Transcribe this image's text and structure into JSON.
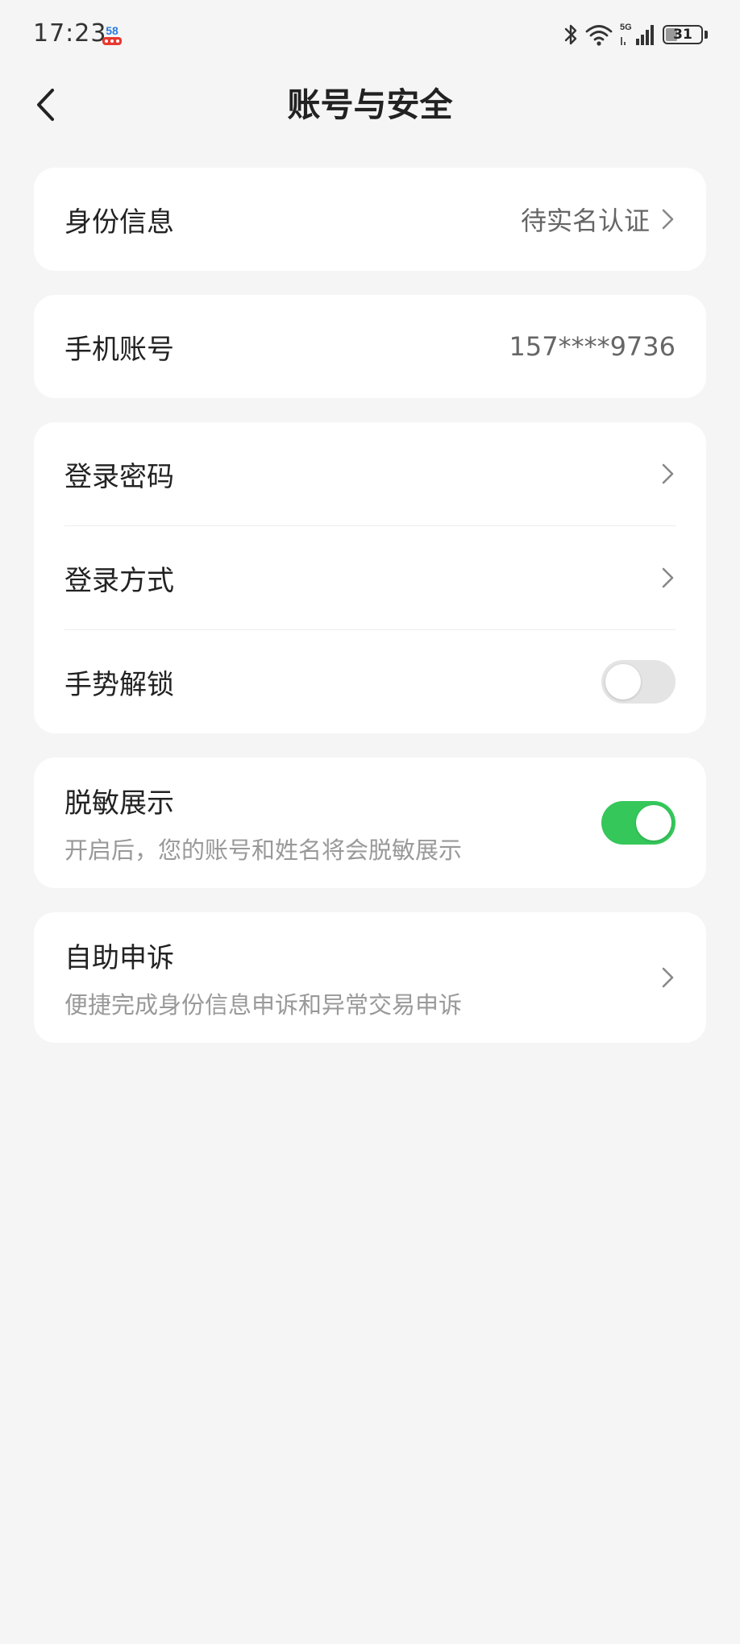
{
  "status_bar": {
    "time": "17:23",
    "app_badge": "58",
    "network": "5G",
    "battery": "31"
  },
  "header": {
    "title": "账号与安全"
  },
  "identity": {
    "label": "身份信息",
    "value": "待实名认证"
  },
  "phone": {
    "label": "手机账号",
    "value": "157****9736"
  },
  "login": {
    "password_label": "登录密码",
    "method_label": "登录方式",
    "gesture_label": "手势解锁",
    "gesture_enabled": false
  },
  "desensitize": {
    "label": "脱敏展示",
    "description": "开启后，您的账号和姓名将会脱敏展示",
    "enabled": true
  },
  "appeal": {
    "label": "自助申诉",
    "description": "便捷完成身份信息申诉和异常交易申诉"
  },
  "colors": {
    "toggle_on": "#35c75a",
    "toggle_off": "#e4e4e4",
    "background": "#f5f5f5"
  }
}
